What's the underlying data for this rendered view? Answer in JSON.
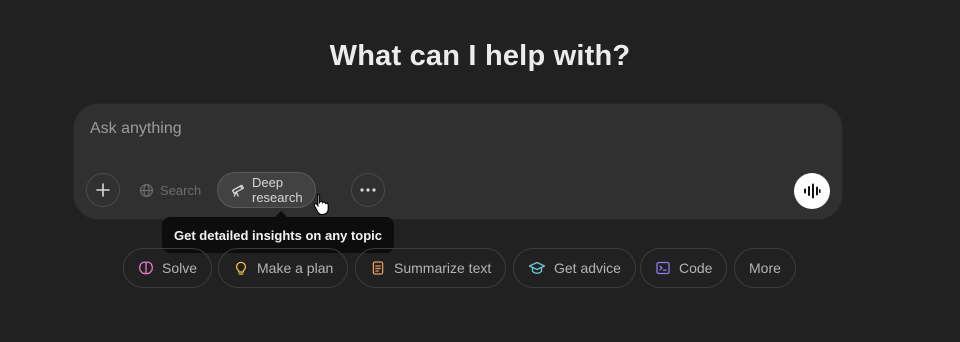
{
  "headline": "What can I help with?",
  "composer": {
    "placeholder": "Ask anything",
    "add_icon": "plus-icon",
    "search_label": "Search",
    "deep_research_label": "Deep research",
    "more_tools_icon": "ellipsis-icon",
    "voice_icon": "voice-waveform-icon",
    "tooltip": "Get detailed insights on any topic"
  },
  "chips": [
    {
      "label": "Solve",
      "icon": "brain-icon",
      "color": "#e879c9"
    },
    {
      "label": "Make a plan",
      "icon": "lightbulb-icon",
      "color": "#e8c547"
    },
    {
      "label": "Summarize text",
      "icon": "document-icon",
      "color": "#e89a53"
    },
    {
      "label": "Get advice",
      "icon": "graduation-cap-icon",
      "color": "#6bc8d8"
    },
    {
      "label": "Code",
      "icon": "terminal-icon",
      "color": "#8b7cf0"
    },
    {
      "label": "More",
      "icon": "",
      "color": "#b4b4b4"
    }
  ]
}
